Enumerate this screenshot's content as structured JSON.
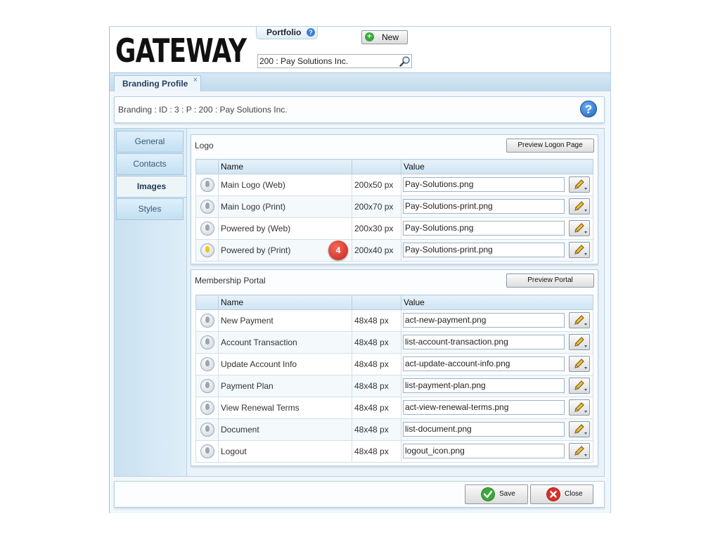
{
  "header": {
    "logo_text": "GATEWAY",
    "portfolio_label": "Portfolio",
    "new_label": "New",
    "search_value": "200 : Pay Solutions Inc."
  },
  "tabs": [
    {
      "label": "Branding Profile",
      "close": "×"
    }
  ],
  "breadcrumb": "Branding : ID : 3 : P : 200 : Pay Solutions Inc.",
  "sidebar": {
    "items": [
      {
        "label": "General"
      },
      {
        "label": "Contacts"
      },
      {
        "label": "Images",
        "active": true
      },
      {
        "label": "Styles"
      }
    ]
  },
  "logo_group": {
    "title": "Logo",
    "preview_label": "Preview Logon Page",
    "columns": [
      "Name",
      "Value"
    ],
    "rows": [
      {
        "name": "Main Logo (Web)",
        "size": "200x50 px",
        "value": "Pay-Solutions.png"
      },
      {
        "name": "Main Logo (Print)",
        "size": "200x70 px",
        "value": "Pay-Solutions-print.png"
      },
      {
        "name": "Powered by (Web)",
        "size": "200x30 px",
        "value": "Pay-Solutions.png"
      },
      {
        "name": "Powered by (Print)",
        "size": "200x40 px",
        "value": "Pay-Solutions-print.png",
        "badge": "4"
      }
    ]
  },
  "membership_group": {
    "title": "Membership Portal",
    "preview_label": "Preview Portal",
    "columns": [
      "Name",
      "Value"
    ],
    "rows": [
      {
        "name": "New Payment",
        "size": "48x48 px",
        "value": "act-new-payment.png"
      },
      {
        "name": "Account Transaction",
        "size": "48x48 px",
        "value": "list-account-transaction.png"
      },
      {
        "name": "Update Account Info",
        "size": "48x48 px",
        "value": "act-update-account-info.png"
      },
      {
        "name": "Payment Plan",
        "size": "48x48 px",
        "value": "list-payment-plan.png"
      },
      {
        "name": "View Renewal Terms",
        "size": "48x48 px",
        "value": "act-view-renewal-terms.png"
      },
      {
        "name": "Document",
        "size": "48x48 px",
        "value": "list-document.png"
      },
      {
        "name": "Logout",
        "size": "48x48 px",
        "value": "logout_icon.png"
      }
    ]
  },
  "footer": {
    "save_label": "Save",
    "close_label": "Close"
  }
}
